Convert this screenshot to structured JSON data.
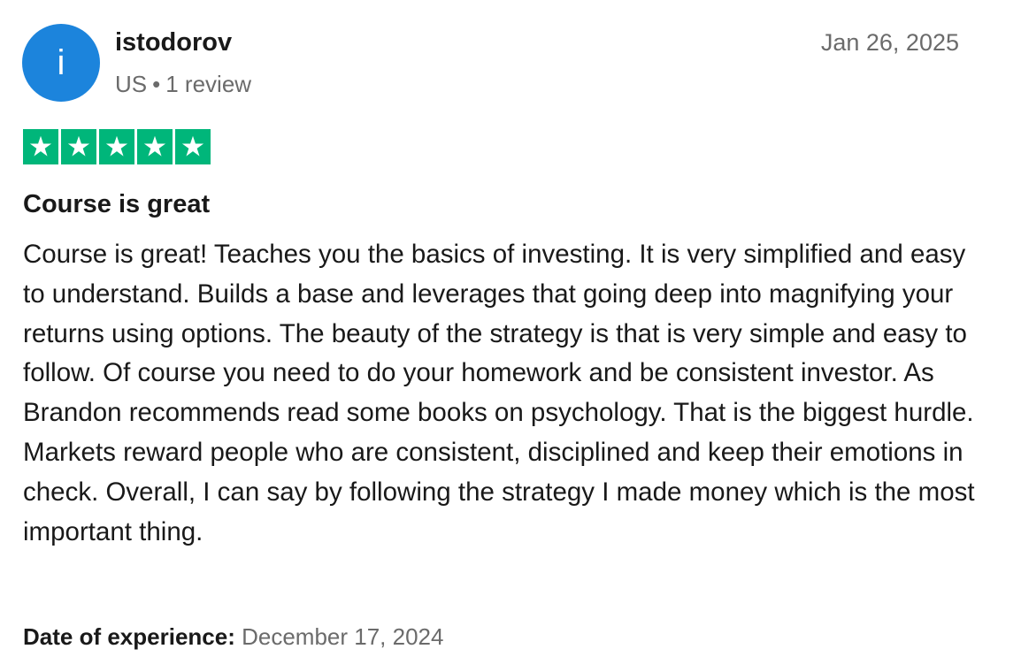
{
  "reviewer": {
    "avatar_initial": "i",
    "avatar_color": "#1c84dc",
    "name": "istodorov",
    "country": "US",
    "separator": "•",
    "review_count": "1 review"
  },
  "review": {
    "date": "Jan 26, 2025",
    "rating": 5,
    "rating_max": 5,
    "star_color": "#00b67a",
    "title": "Course is great",
    "body": "Course is great! Teaches you the basics of investing. It is very simplified and easy to understand. Builds a base and leverages that going deep into magnifying your returns using options. The beauty of the strategy is that is very simple and easy to follow. Of course you need to do your homework and be consistent investor. As Brandon recommends read some books on psychology. That is the biggest hurdle. Markets reward people who are consistent, disciplined and keep their emotions in check. Overall, I can say by following the strategy I made money which is the most important thing.",
    "experience_label": "Date of experience:",
    "experience_date": "December 17, 2024"
  },
  "icons": {
    "star": "star-icon"
  }
}
